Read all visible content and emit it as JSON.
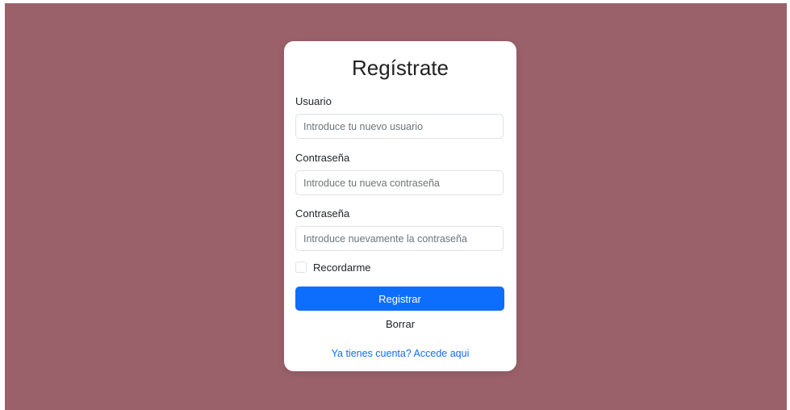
{
  "background_color": "#9b616a",
  "accent_color": "#0d6efd",
  "form": {
    "title": "Regístrate",
    "username": {
      "label": "Usuario",
      "placeholder": "Introduce tu nuevo usuario",
      "value": ""
    },
    "password": {
      "label": "Contraseña",
      "placeholder": "Introduce tu nueva contraseña",
      "value": ""
    },
    "password_confirm": {
      "label": "Contraseña",
      "placeholder": "Introduce nuevamente la contraseña",
      "value": ""
    },
    "remember": {
      "label": "Recordarme",
      "checked": false
    },
    "submit_label": "Registrar",
    "reset_label": "Borrar",
    "login_link": "Ya tienes cuenta? Accede aqui"
  }
}
